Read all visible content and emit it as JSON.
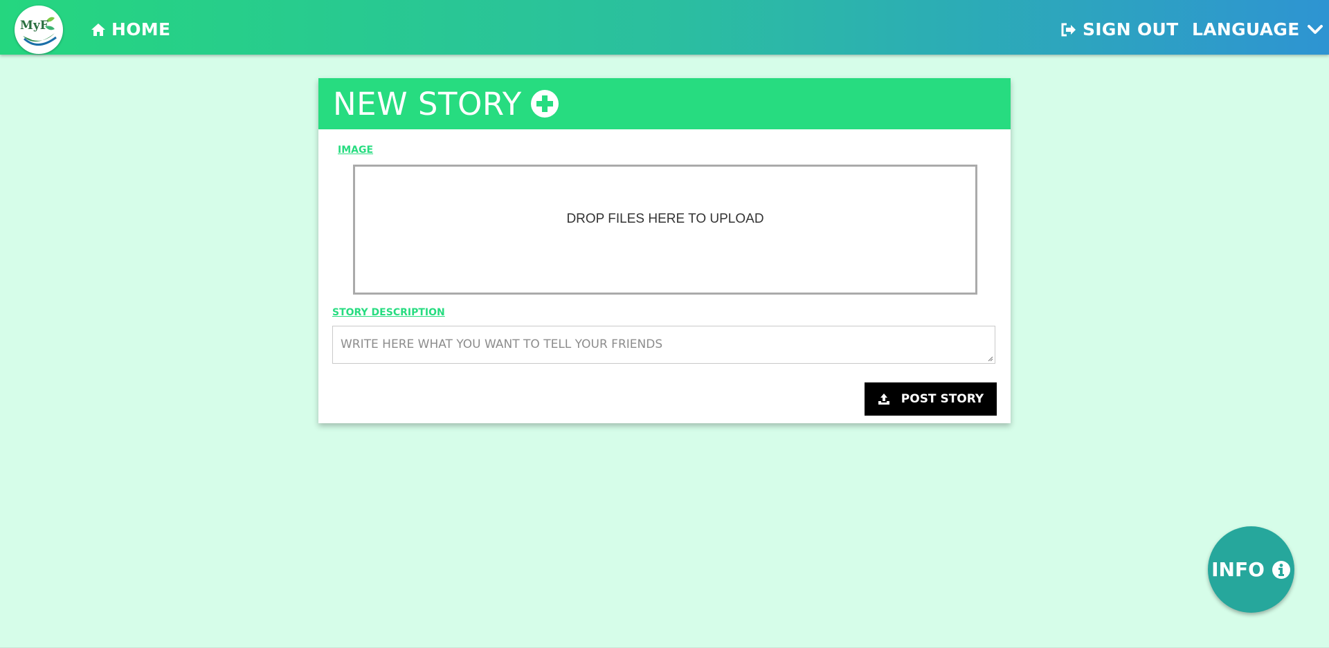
{
  "app": {
    "logo_text": "MyF",
    "colors": {
      "nav_start": "#25d67f",
      "nav_end": "#2e94d2",
      "accent": "#27dc80",
      "page_bg": "#d6fde9",
      "fab": "#26a79c"
    }
  },
  "nav": {
    "home_label": "HOME",
    "home_icon": "home-icon",
    "signout_label": "SIGN OUT",
    "signout_icon": "sign-out-icon",
    "language_label": "LANGUAGE",
    "language_icon": "chevron-down-icon"
  },
  "card": {
    "title": "NEW STORY",
    "title_icon": "plus-circle-icon",
    "image_label": "IMAGE",
    "dropzone_text": "DROP FILES HERE TO UPLOAD",
    "description_label": "STORY DESCRIPTION",
    "description_placeholder": "WRITE HERE WHAT YOU WANT TO TELL YOUR FRIENDS",
    "description_value": "",
    "post_button_label": "POST STORY",
    "post_button_icon": "upload-icon"
  },
  "fab": {
    "label": "INFO",
    "icon": "info-circle-icon"
  }
}
